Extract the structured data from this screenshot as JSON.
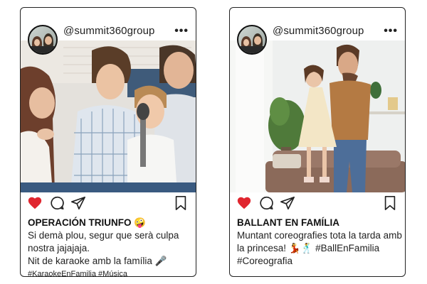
{
  "posts": [
    {
      "username": "@summit360group",
      "more": "•••",
      "title": "OPERACIÓN TRIUNFO 🤪",
      "caption_lines": [
        "Si demà plou, segur que serà culpa",
        "nostra jajajaja.",
        "Nit de karaoke amb la família 🎤"
      ],
      "hashtags": "#KaraokeEnFamilia #Música",
      "liked": true
    },
    {
      "username": "@summit360group",
      "more": "•••",
      "title": "BALLANT EN FAMÍLIA",
      "caption_lines": [
        "Muntant coreografies tota la tarda amb",
        "la princesa! 💃🕺 #BallEnFamilia",
        "#Coreografia"
      ],
      "hashtags": "",
      "liked": true
    }
  ],
  "colors": {
    "heart": "#e0262f",
    "ink": "#222222"
  },
  "icons": [
    "heart-icon",
    "comment-icon",
    "share-icon",
    "bookmark-icon",
    "more-icon"
  ]
}
